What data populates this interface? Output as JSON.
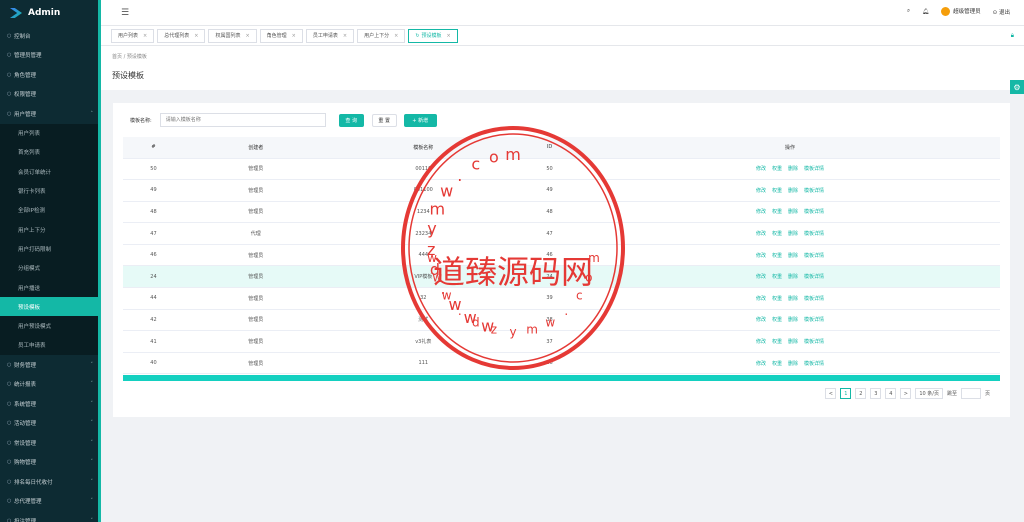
{
  "app": {
    "title": "Admin"
  },
  "sidebar": {
    "items": [
      {
        "label": "控制台",
        "icon": "dashboard-icon"
      },
      {
        "label": "管理员管理",
        "icon": "user-icon"
      },
      {
        "label": "角色管理",
        "icon": "role-icon"
      },
      {
        "label": "权限管理",
        "icon": "permission-icon"
      },
      {
        "label": "用户管理",
        "icon": "user-icon",
        "expanded": true
      }
    ],
    "subitems": [
      "用户列表",
      "首充列表",
      "会员订单统计",
      "银行卡列表",
      "全部IP检测",
      "用户上下分",
      "用户打码限制",
      "分组模式",
      "用户播送",
      "预设模板",
      "用户预设模式",
      "员工申请表"
    ],
    "active_sub": "预设模板",
    "items_after": [
      {
        "label": "财务管理"
      },
      {
        "label": "统计报表"
      },
      {
        "label": "系统管理"
      },
      {
        "label": "活动管理"
      },
      {
        "label": "常设管理"
      },
      {
        "label": "购物管理"
      },
      {
        "label": "排名每日代收付"
      },
      {
        "label": "总代理管理"
      },
      {
        "label": "投注管理"
      }
    ]
  },
  "topbar": {
    "user": "超级管理员",
    "logout": "退出"
  },
  "tabs": [
    {
      "label": "用户列表"
    },
    {
      "label": "总代理列表"
    },
    {
      "label": "权属国列表"
    },
    {
      "label": "角色管理"
    },
    {
      "label": "员工申请表"
    },
    {
      "label": "用户上下分"
    },
    {
      "label": "预设模板",
      "active": true
    }
  ],
  "breadcrumb": {
    "home": "首页",
    "sep": "/",
    "current": "预设模板"
  },
  "page_title": "预设模板",
  "filter": {
    "label": "模板名称:",
    "placeholder": "请输入模板名称",
    "search": "查 询",
    "reset": "重 置",
    "add": "+ 新增"
  },
  "table": {
    "headers": [
      "#",
      "创建者",
      "模板名称",
      "ID",
      "操作"
    ],
    "rows": [
      [
        "50",
        "管理员",
        "00110",
        "50"
      ],
      [
        "49",
        "管理员",
        "001100",
        "49"
      ],
      [
        "48",
        "管理员",
        "1234",
        "48"
      ],
      [
        "47",
        "代理",
        "23234",
        "47"
      ],
      [
        "46",
        "管理员",
        "444",
        "46"
      ],
      [
        "24",
        "管理员",
        "VIP模板",
        "24"
      ],
      [
        "44",
        "管理员",
        "32",
        "39"
      ],
      [
        "42",
        "管理员",
        "测试",
        "38"
      ],
      [
        "41",
        "管理员",
        "v3礼表",
        "37"
      ],
      [
        "40",
        "管理员",
        "111",
        "36"
      ]
    ],
    "highlight_row": 5,
    "ops": [
      "修改",
      "权重",
      "删除",
      "模板详情"
    ]
  },
  "pager": {
    "pages": [
      "1",
      "2",
      "3",
      "4"
    ],
    "current": "1",
    "prev": "<",
    "next": ">",
    "size": "10 条/页",
    "goto": "跳至",
    "page_unit": "页"
  },
  "watermark": {
    "center": "道臻源码网",
    "ring": "www.dzymw.com",
    "color": "#e53935"
  }
}
